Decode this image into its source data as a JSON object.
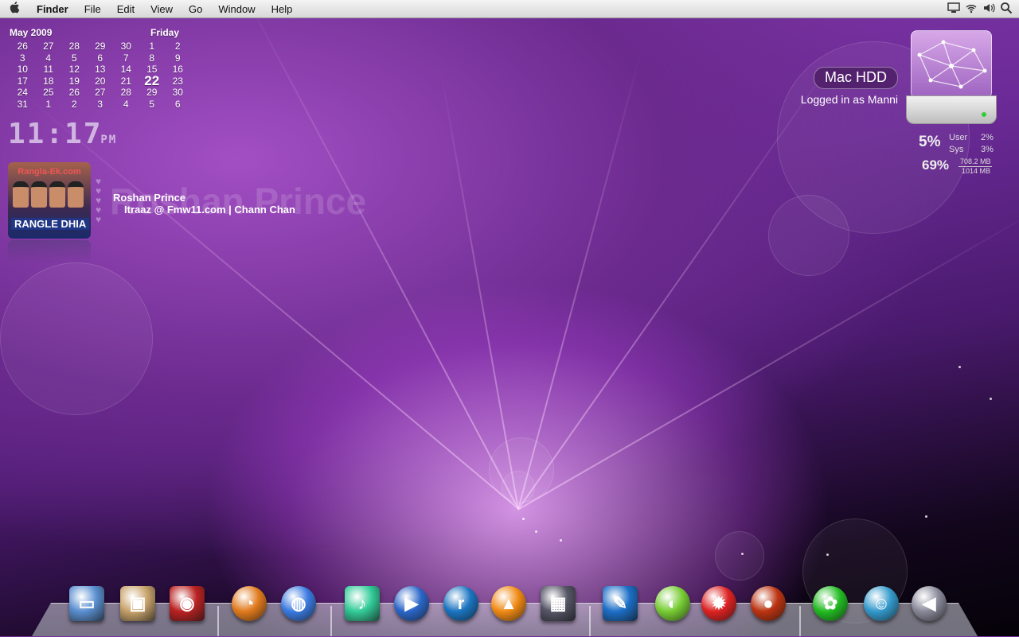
{
  "menubar": {
    "apple": "",
    "app": "Finder",
    "items": [
      "File",
      "Edit",
      "View",
      "Go",
      "Window",
      "Help"
    ],
    "status_icons": [
      "display-icon",
      "wifi-icon",
      "volume-icon",
      "spotlight-icon"
    ]
  },
  "calendar": {
    "month": "May 2009",
    "weekday": "Friday",
    "days": [
      "26",
      "27",
      "28",
      "29",
      "30",
      "1",
      "2",
      "3",
      "4",
      "5",
      "6",
      "7",
      "8",
      "9",
      "10",
      "11",
      "12",
      "13",
      "14",
      "15",
      "16",
      "17",
      "18",
      "19",
      "20",
      "21",
      "22",
      "23",
      "24",
      "25",
      "26",
      "27",
      "28",
      "29",
      "30",
      "31",
      "1",
      "2",
      "3",
      "4",
      "5",
      "6"
    ],
    "today": "22"
  },
  "clock": {
    "time": "11:17",
    "ampm": "PM"
  },
  "now_playing": {
    "album_caption": "Rangla-Ek.com",
    "album_title": "RANGLE DHIA",
    "artist": "Roshan Prince",
    "track": "Itraaz @ Fmw11.com | Chann Chan"
  },
  "drive": {
    "name": "Mac HDD",
    "status": "Logged in as Manni"
  },
  "cpu": {
    "cpu_pct": "5%",
    "user_label": "User",
    "user_val": "2%",
    "sys_label": "Sys",
    "sys_val": "3%",
    "mem_pct": "69%",
    "mem_used": "708.2 MB",
    "mem_total": "1014 MB"
  },
  "dock": {
    "items": [
      {
        "name": "finder-display",
        "icon": "monitor-icon",
        "color": "#5a8fd0"
      },
      {
        "name": "iphoto",
        "icon": "photo-icon",
        "color": "#c9a36c"
      },
      {
        "name": "photo-booth",
        "icon": "camera-icon",
        "color": "#b22"
      },
      {
        "name": "firefox",
        "icon": "firefox-icon",
        "color": "#e07a1c"
      },
      {
        "name": "safari",
        "icon": "globe-icon",
        "color": "#3a7ae0"
      },
      {
        "name": "itunes-media",
        "icon": "music-icon",
        "color": "#3c9"
      },
      {
        "name": "windows-media-player",
        "icon": "play-icon",
        "color": "#2a66c8"
      },
      {
        "name": "realplayer",
        "icon": "real-icon",
        "color": "#1a74c0"
      },
      {
        "name": "vlc",
        "icon": "vlc-cone-icon",
        "color": "#f08a14"
      },
      {
        "name": "imovie",
        "icon": "clapper-icon",
        "color": "#556"
      },
      {
        "name": "feather-app",
        "icon": "feather-icon",
        "color": "#1c6fc7"
      },
      {
        "name": "limewire",
        "icon": "lime-icon",
        "color": "#7c3"
      },
      {
        "name": "burn",
        "icon": "flame-icon",
        "color": "#d22"
      },
      {
        "name": "fireball-app",
        "icon": "fire-orb-icon",
        "color": "#b31"
      },
      {
        "name": "icq",
        "icon": "flower-icon",
        "color": "#2b2"
      },
      {
        "name": "msn-messenger",
        "icon": "buddy-icon",
        "color": "#39c"
      },
      {
        "name": "megaphone-app",
        "icon": "megaphone-icon",
        "color": "#889"
      }
    ]
  }
}
